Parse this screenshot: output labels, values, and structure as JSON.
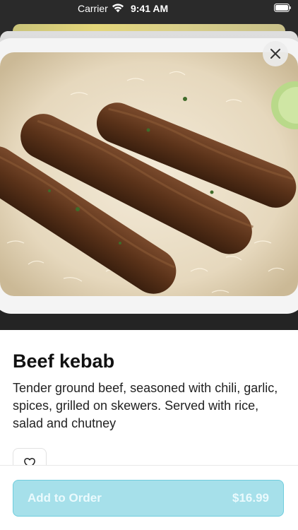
{
  "status_bar": {
    "carrier": "Carrier",
    "time": "9:41 AM",
    "wifi_icon": "wifi-icon",
    "battery_icon": "battery-icon"
  },
  "item": {
    "title": "Beef kebab",
    "description": "Tender ground beef, seasoned with chili, garlic, spices, grilled on skewers. Served with rice, salad and chutney",
    "image": "beef-kebab-photo"
  },
  "actions": {
    "close_icon": "close-icon",
    "favorite_icon": "heart-outline-icon",
    "add_to_order_label": "Add to Order",
    "price": "$16.99"
  },
  "colors": {
    "button_bg": "#a6e0ea",
    "button_border": "#6fcddd",
    "button_text": "#eafafd"
  }
}
